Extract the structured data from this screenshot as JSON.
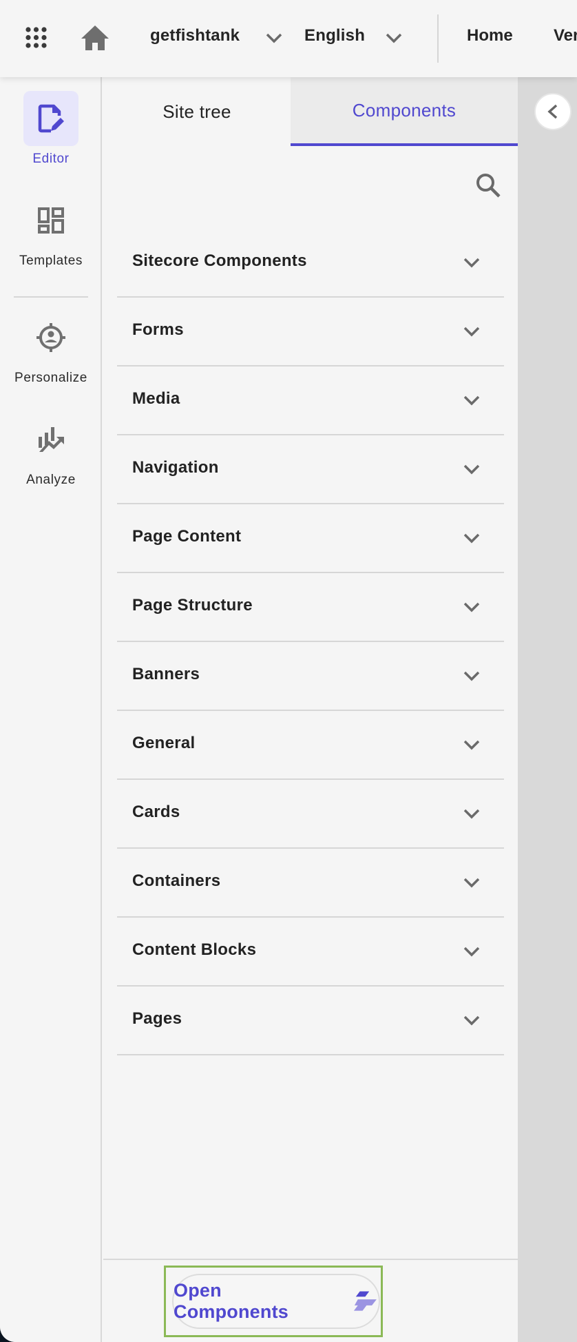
{
  "topbar": {
    "apps_icon": "apps-grid-icon",
    "home_icon": "home-icon",
    "site_selector": "getfishtank",
    "language_selector": "English",
    "nav_links": [
      "Home",
      "Ver"
    ]
  },
  "rail": {
    "items": [
      {
        "label": "Editor",
        "icon": "page-edit-icon",
        "active": true
      },
      {
        "label": "Templates",
        "icon": "dashboard-layout-icon",
        "active": false
      },
      {
        "label": "Personalize",
        "icon": "target-person-icon",
        "active": false
      },
      {
        "label": "Analyze",
        "icon": "chart-trend-icon",
        "active": false
      }
    ]
  },
  "panel": {
    "tabs": [
      {
        "label": "Site tree",
        "active": false
      },
      {
        "label": "Components",
        "active": true
      }
    ],
    "search_icon": "search-icon",
    "categories": [
      "Sitecore Components",
      "Forms",
      "Media",
      "Navigation",
      "Page Content",
      "Page Structure",
      "Banners",
      "General",
      "Cards",
      "Containers",
      "Content Blocks",
      "Pages"
    ],
    "open_button": {
      "label": "Open Components",
      "icon": "components-logo-icon"
    }
  },
  "canvas": {
    "collapse_icon": "chevron-left-icon"
  },
  "colors": {
    "accent": "#5048cf",
    "accent_light": "#e7e6fb",
    "focus_ring": "#8bb956",
    "panel_bg": "#f5f5f5",
    "canvas_bg": "#d9d9d9"
  }
}
